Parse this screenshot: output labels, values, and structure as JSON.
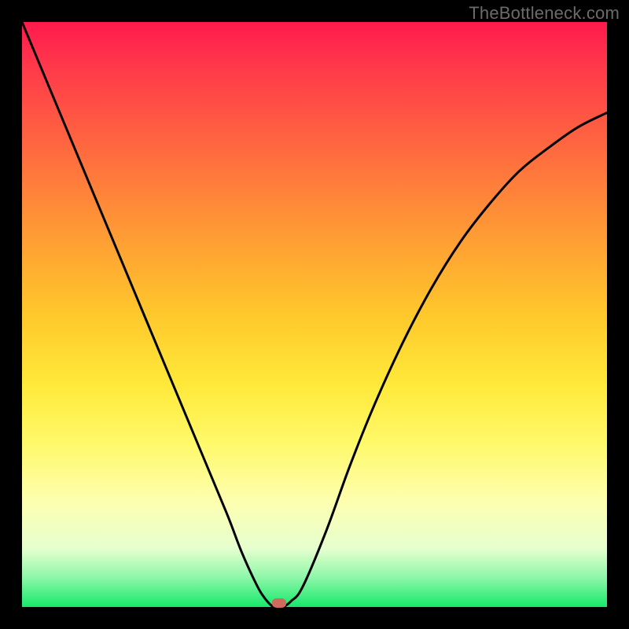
{
  "watermark": "TheBottleneck.com",
  "chart_data": {
    "type": "line",
    "title": "",
    "xlabel": "",
    "ylabel": "",
    "xlim": [
      0,
      1
    ],
    "ylim": [
      0,
      1
    ],
    "x": [
      0.0,
      0.05,
      0.1,
      0.15,
      0.2,
      0.25,
      0.3,
      0.35,
      0.375,
      0.4,
      0.415,
      0.43,
      0.445,
      0.46,
      0.48,
      0.52,
      0.56,
      0.6,
      0.65,
      0.7,
      0.75,
      0.8,
      0.85,
      0.9,
      0.95,
      1.0
    ],
    "values": [
      1.0,
      0.88,
      0.76,
      0.64,
      0.52,
      0.4,
      0.28,
      0.16,
      0.095,
      0.04,
      0.015,
      0.0,
      0.0,
      0.01,
      0.035,
      0.13,
      0.24,
      0.34,
      0.45,
      0.545,
      0.625,
      0.69,
      0.745,
      0.785,
      0.82,
      0.845
    ],
    "minimum": {
      "x": 0.44,
      "y": 0.0
    },
    "background_gradient": [
      "#ff1a4d",
      "#ffe93a",
      "#17e86b"
    ],
    "curve_color": "#000000",
    "dot_color": "#cf6a5c"
  }
}
